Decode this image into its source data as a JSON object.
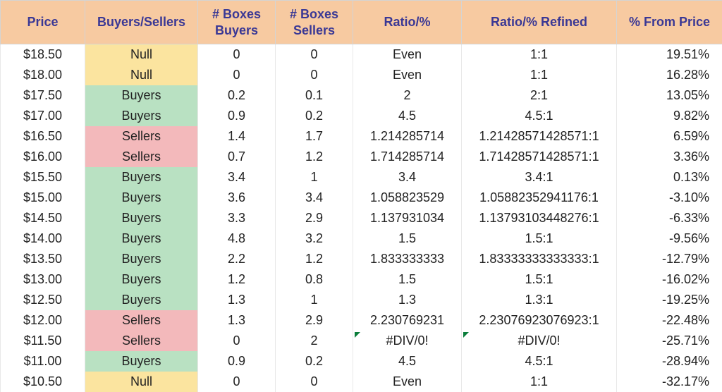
{
  "columns": [
    "Price",
    "Buyers/Sellers",
    "# Boxes Buyers",
    "# Boxes Sellers",
    "Ratio/%",
    "Ratio/% Refined",
    "% From Price"
  ],
  "rows": [
    {
      "price": "$18.50",
      "bs": "Null",
      "boxes_buyers": "0",
      "boxes_sellers": "0",
      "ratio": "Even",
      "ratio_refined": "1:1",
      "pct_from_price": "19.51%"
    },
    {
      "price": "$18.00",
      "bs": "Null",
      "boxes_buyers": "0",
      "boxes_sellers": "0",
      "ratio": "Even",
      "ratio_refined": "1:1",
      "pct_from_price": "16.28%"
    },
    {
      "price": "$17.50",
      "bs": "Buyers",
      "boxes_buyers": "0.2",
      "boxes_sellers": "0.1",
      "ratio": "2",
      "ratio_refined": "2:1",
      "pct_from_price": "13.05%"
    },
    {
      "price": "$17.00",
      "bs": "Buyers",
      "boxes_buyers": "0.9",
      "boxes_sellers": "0.2",
      "ratio": "4.5",
      "ratio_refined": "4.5:1",
      "pct_from_price": "9.82%"
    },
    {
      "price": "$16.50",
      "bs": "Sellers",
      "boxes_buyers": "1.4",
      "boxes_sellers": "1.7",
      "ratio": "1.214285714",
      "ratio_refined": "1.21428571428571:1",
      "pct_from_price": "6.59%"
    },
    {
      "price": "$16.00",
      "bs": "Sellers",
      "boxes_buyers": "0.7",
      "boxes_sellers": "1.2",
      "ratio": "1.714285714",
      "ratio_refined": "1.71428571428571:1",
      "pct_from_price": "3.36%"
    },
    {
      "price": "$15.50",
      "bs": "Buyers",
      "boxes_buyers": "3.4",
      "boxes_sellers": "1",
      "ratio": "3.4",
      "ratio_refined": "3.4:1",
      "pct_from_price": "0.13%"
    },
    {
      "price": "$15.00",
      "bs": "Buyers",
      "boxes_buyers": "3.6",
      "boxes_sellers": "3.4",
      "ratio": "1.058823529",
      "ratio_refined": "1.05882352941176:1",
      "pct_from_price": "-3.10%"
    },
    {
      "price": "$14.50",
      "bs": "Buyers",
      "boxes_buyers": "3.3",
      "boxes_sellers": "2.9",
      "ratio": "1.137931034",
      "ratio_refined": "1.13793103448276:1",
      "pct_from_price": "-6.33%"
    },
    {
      "price": "$14.00",
      "bs": "Buyers",
      "boxes_buyers": "4.8",
      "boxes_sellers": "3.2",
      "ratio": "1.5",
      "ratio_refined": "1.5:1",
      "pct_from_price": "-9.56%"
    },
    {
      "price": "$13.50",
      "bs": "Buyers",
      "boxes_buyers": "2.2",
      "boxes_sellers": "1.2",
      "ratio": "1.833333333",
      "ratio_refined": "1.83333333333333:1",
      "pct_from_price": "-12.79%"
    },
    {
      "price": "$13.00",
      "bs": "Buyers",
      "boxes_buyers": "1.2",
      "boxes_sellers": "0.8",
      "ratio": "1.5",
      "ratio_refined": "1.5:1",
      "pct_from_price": "-16.02%"
    },
    {
      "price": "$12.50",
      "bs": "Buyers",
      "boxes_buyers": "1.3",
      "boxes_sellers": "1",
      "ratio": "1.3",
      "ratio_refined": "1.3:1",
      "pct_from_price": "-19.25%"
    },
    {
      "price": "$12.00",
      "bs": "Sellers",
      "boxes_buyers": "1.3",
      "boxes_sellers": "2.9",
      "ratio": "2.230769231",
      "ratio_refined": "2.23076923076923:1",
      "pct_from_price": "-22.48%"
    },
    {
      "price": "$11.50",
      "bs": "Sellers",
      "boxes_buyers": "0",
      "boxes_sellers": "2",
      "ratio": "#DIV/0!",
      "ratio_refined": "#DIV/0!",
      "pct_from_price": "-25.71%",
      "err": true
    },
    {
      "price": "$11.00",
      "bs": "Buyers",
      "boxes_buyers": "0.9",
      "boxes_sellers": "0.2",
      "ratio": "4.5",
      "ratio_refined": "4.5:1",
      "pct_from_price": "-28.94%"
    },
    {
      "price": "$10.50",
      "bs": "Null",
      "boxes_buyers": "0",
      "boxes_sellers": "0",
      "ratio": "Even",
      "ratio_refined": "1:1",
      "pct_from_price": "-32.17%"
    }
  ]
}
